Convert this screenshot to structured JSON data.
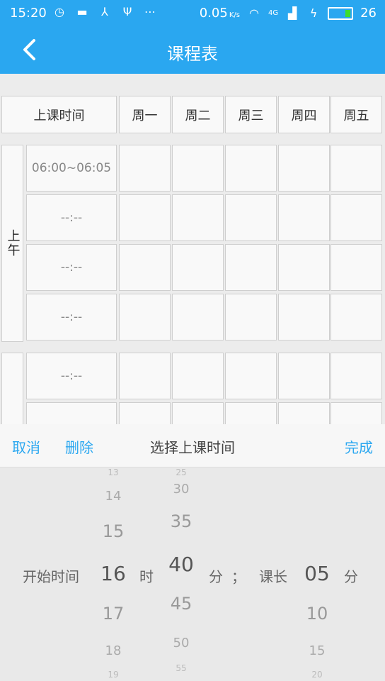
{
  "status_bar": {
    "time": "15:20",
    "speed": "0.05",
    "speed_unit": "K/s",
    "network": "4G",
    "battery": "26"
  },
  "app_bar": {
    "title": "课程表"
  },
  "table": {
    "header_time": "上课时间",
    "days": [
      "周一",
      "周二",
      "周三",
      "周四",
      "周五"
    ],
    "section_morning": "上午",
    "morning_times": [
      "06:00~06:05",
      "--:--",
      "--:--",
      "--:--"
    ],
    "afternoon_times": [
      "--:--",
      ""
    ]
  },
  "picker_toolbar": {
    "cancel": "取消",
    "delete": "删除",
    "title": "选择上课时间",
    "done": "完成"
  },
  "picker": {
    "start_label": "开始时间",
    "hour_unit": "时",
    "minute_unit": "分",
    "separator": "；",
    "duration_label": "课长",
    "duration_unit": "分",
    "hours": [
      "13",
      "14",
      "15",
      "16",
      "17",
      "18",
      "19"
    ],
    "minutes": [
      "25",
      "30",
      "35",
      "40",
      "45",
      "50",
      "55"
    ],
    "durations": [
      "05",
      "10",
      "15",
      "20"
    ]
  },
  "colors": {
    "primary": "#2aa7f0",
    "battery_level": "#3ddc2f"
  }
}
